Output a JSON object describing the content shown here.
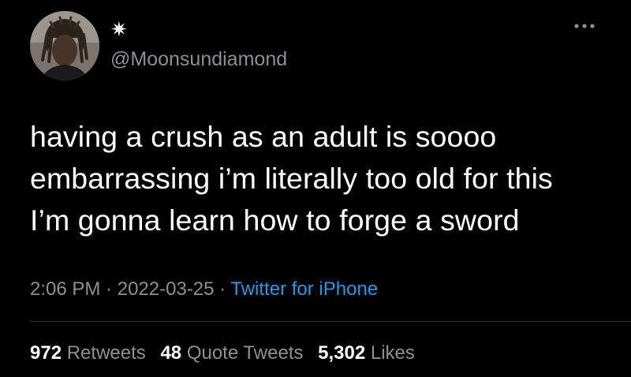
{
  "tweet": {
    "display_name": "✷",
    "handle": "@Moonsundiamond",
    "more_icon": "more-horizontal-icon",
    "text": "having a crush as an adult is soooo\nembarrassing i’m literally too old for this\nI’m gonna learn how to forge a sword",
    "time": "2:06 PM",
    "separator": " · ",
    "date": "2022-03-25",
    "source": "Twitter for iPhone"
  },
  "stats": {
    "retweets_count": "972",
    "retweets_label": "Retweets",
    "quotes_count": "48",
    "quotes_label": "Quote Tweets",
    "likes_count": "5,302",
    "likes_label": "Likes"
  },
  "colors": {
    "background": "#000000",
    "text_primary": "#ffffff",
    "text_secondary": "#8b9094",
    "link": "#1d9bf0",
    "divider": "#2f3336"
  }
}
